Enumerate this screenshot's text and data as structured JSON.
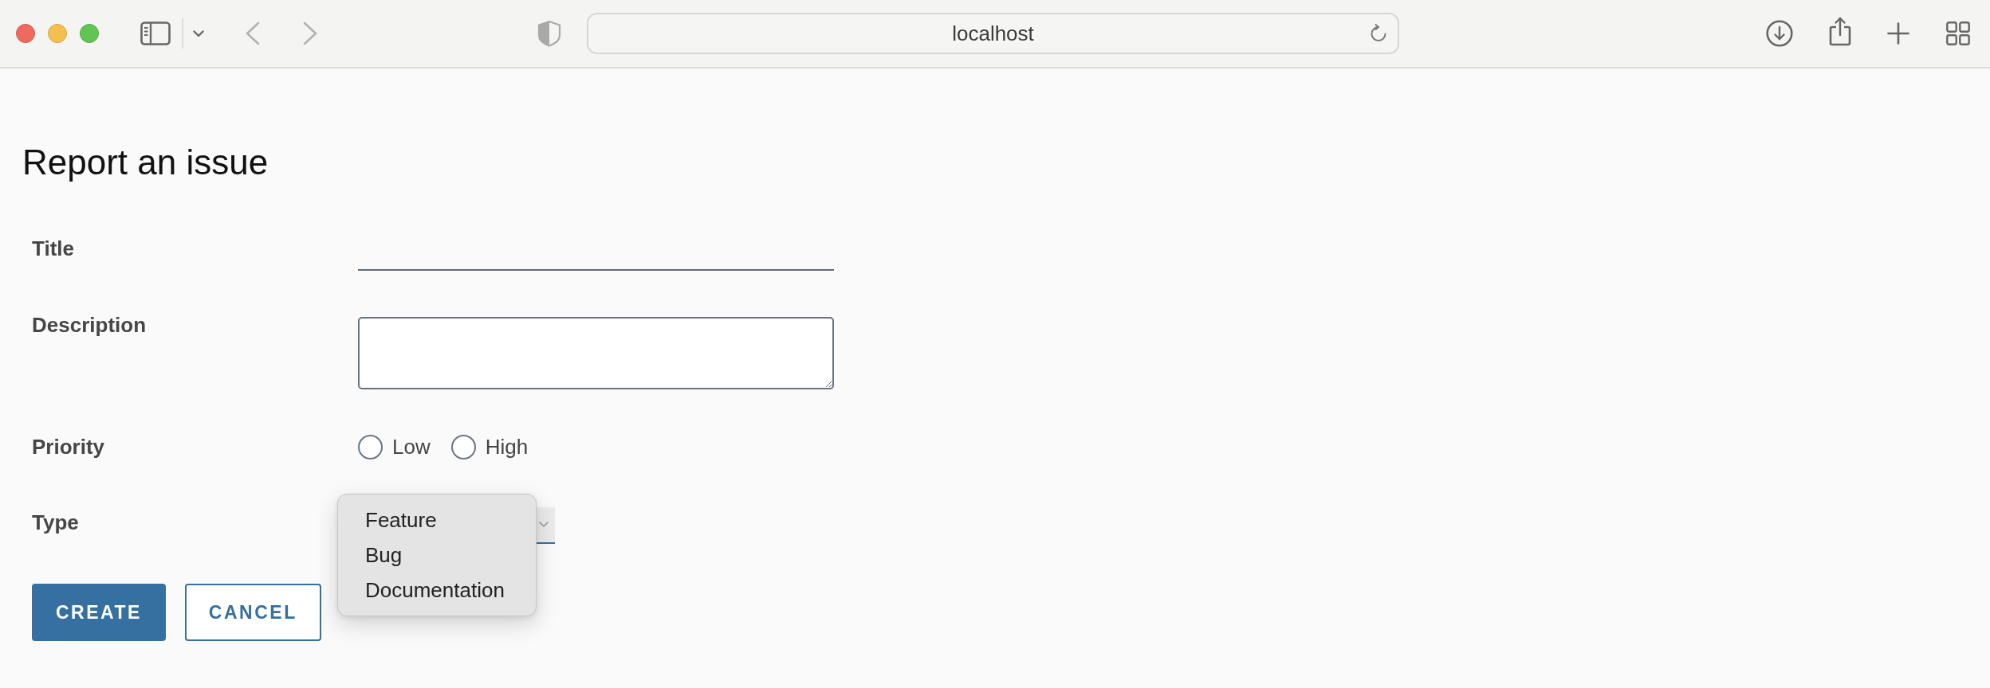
{
  "browser": {
    "address": "localhost"
  },
  "page": {
    "title": "Report an issue"
  },
  "form": {
    "fields": [
      {
        "kind": "text",
        "label": "Title"
      },
      {
        "kind": "textarea",
        "label": "Description"
      },
      {
        "kind": "radio",
        "label": "Priority",
        "options": [
          {
            "label": "Low",
            "checked": false
          },
          {
            "label": "High",
            "checked": false
          }
        ]
      },
      {
        "kind": "select",
        "label": "Type",
        "open": true,
        "options": [
          {
            "label": "Feature",
            "selected": false
          },
          {
            "label": "Bug",
            "selected": false
          },
          {
            "label": "Documentation",
            "selected": false
          }
        ]
      }
    ]
  },
  "buttons": [
    {
      "kind": "primary",
      "label": "CREATE"
    },
    {
      "kind": "secondary",
      "label": "CANCEL"
    }
  ]
}
